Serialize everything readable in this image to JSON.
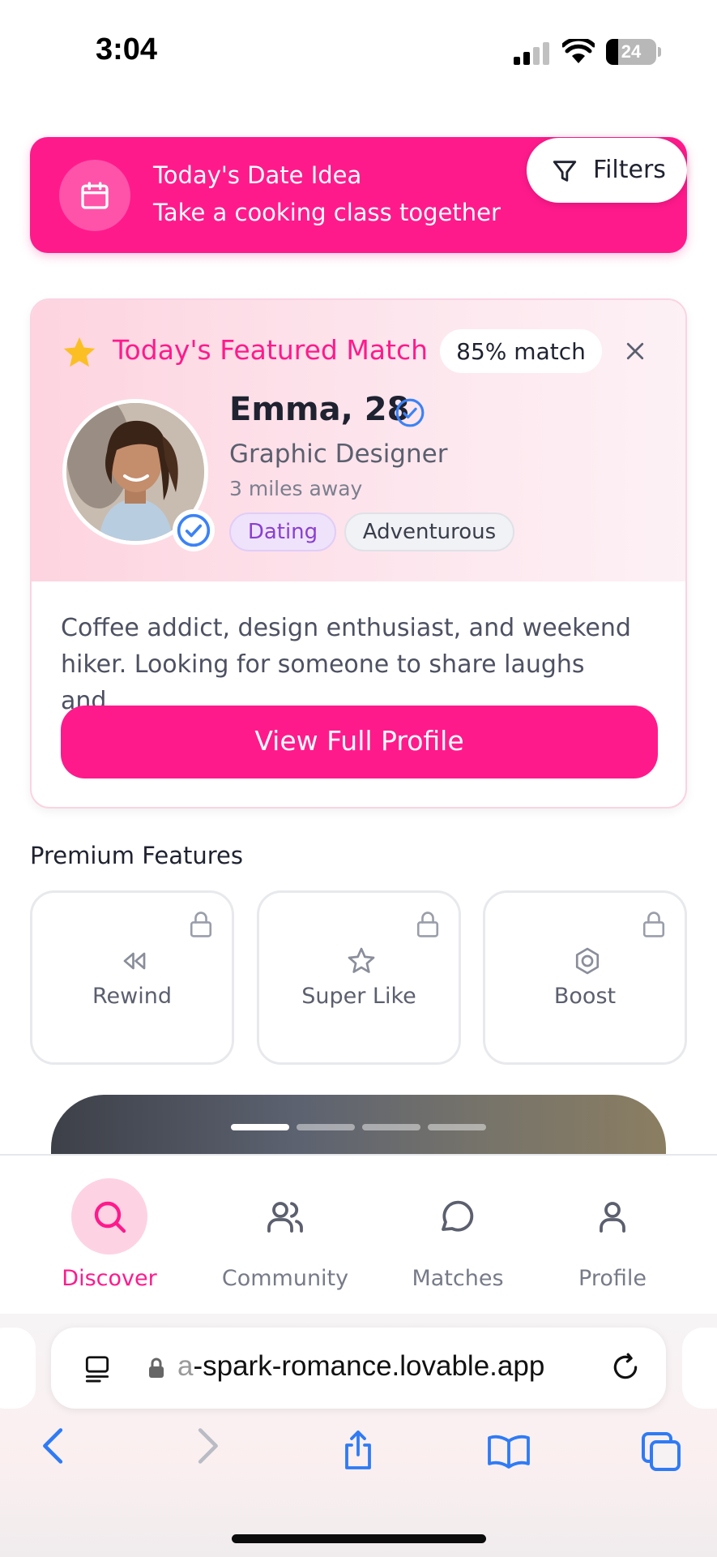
{
  "status_bar": {
    "time": "3:04",
    "battery": "24"
  },
  "date_idea": {
    "title": "Today's Date Idea",
    "subtitle": "Take a cooking class together"
  },
  "filters": {
    "label": "Filters"
  },
  "featured": {
    "title": "Today's Featured Match",
    "match_percent": "85% match",
    "name": "Emma, 28",
    "job": "Graphic Designer",
    "distance": "3 miles away",
    "tags": [
      "Dating",
      "Adventurous"
    ],
    "bio": "Coffee addict, design enthusiast, and weekend hiker. Looking for someone to share laughs and…",
    "cta": "View Full Profile"
  },
  "premium": {
    "heading": "Premium Features",
    "items": [
      {
        "label": "Rewind",
        "icon": "rewind-icon",
        "locked": true
      },
      {
        "label": "Super Like",
        "icon": "star-outline-icon",
        "locked": true
      },
      {
        "label": "Boost",
        "icon": "boost-icon",
        "locked": true
      }
    ]
  },
  "photo_carousel": {
    "slides": 4,
    "active": 1
  },
  "bottom_nav": {
    "items": [
      {
        "label": "Discover",
        "icon": "search-icon",
        "active": true
      },
      {
        "label": "Community",
        "icon": "users-icon",
        "active": false
      },
      {
        "label": "Matches",
        "icon": "chat-bubble-icon",
        "active": false
      },
      {
        "label": "Profile",
        "icon": "user-icon",
        "active": false
      }
    ]
  },
  "browser": {
    "url_prefix": "a",
    "url_main": "-spark-romance.lovable.app"
  },
  "colors": {
    "accent": "#ff1a8c",
    "accent_light": "#fdd3e3",
    "check_blue": "#3b82f6",
    "star_yellow": "#fbbf24"
  }
}
